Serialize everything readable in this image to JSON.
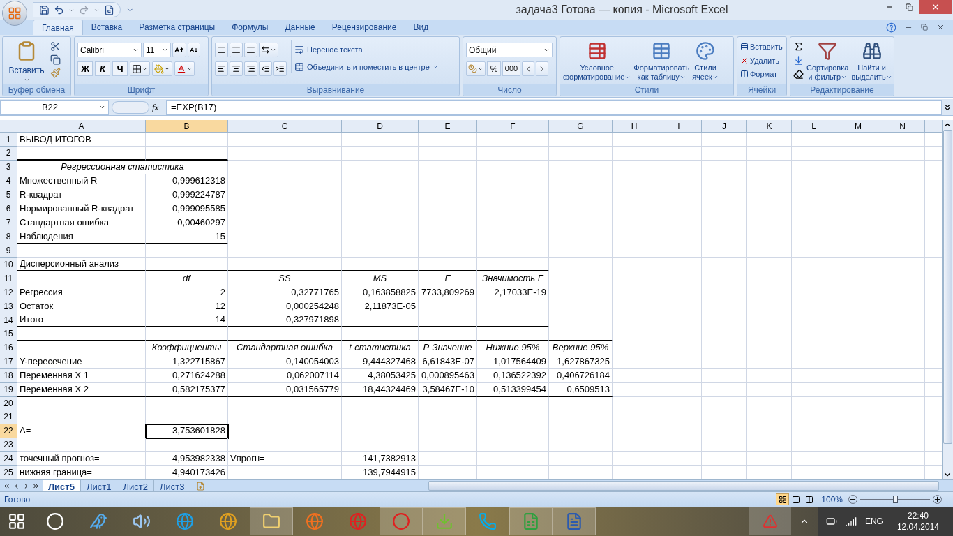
{
  "window": {
    "title": "задача3 Готова — копия - Microsoft Excel"
  },
  "ribbon_tabs": [
    {
      "label": "Главная",
      "selected": true
    },
    {
      "label": "Вставка",
      "selected": false
    },
    {
      "label": "Разметка страницы",
      "selected": false
    },
    {
      "label": "Формулы",
      "selected": false
    },
    {
      "label": "Данные",
      "selected": false
    },
    {
      "label": "Рецензирование",
      "selected": false
    },
    {
      "label": "Вид",
      "selected": false
    }
  ],
  "ribbon": {
    "clipboard": {
      "paste": "Вставить",
      "label": "Буфер обмена"
    },
    "font": {
      "name": "Calibri",
      "size": "11",
      "bold": "Ж",
      "italic": "К",
      "underline": "Ч",
      "label": "Шрифт"
    },
    "alignment": {
      "wrap": "Перенос текста",
      "merge": "Объединить и поместить в центре",
      "label": "Выравнивание"
    },
    "number": {
      "format": "Общий",
      "percent": "%",
      "thousands": "000",
      "label": "Число"
    },
    "styles": {
      "buttons": [
        [
          "Условное",
          "форматирование"
        ],
        [
          "Форматировать",
          "как таблицу"
        ],
        [
          "Стили",
          "ячеек"
        ]
      ],
      "label": "Стили"
    },
    "cells": {
      "buttons": [
        "Вставить",
        "Удалить",
        "Формат"
      ],
      "label": "Ячейки"
    },
    "editing": {
      "buttons": [
        [
          "Сортировка",
          "и фильтр"
        ],
        [
          "Найти и",
          "выделить"
        ]
      ],
      "label": "Редактирование"
    }
  },
  "formula_bar": {
    "name_box": "B22",
    "fx": "fx",
    "formula": "=EXP(B17)"
  },
  "columns": [
    {
      "label": "A",
      "selected": false
    },
    {
      "label": "B",
      "selected": true
    },
    {
      "label": "C",
      "selected": false
    },
    {
      "label": "D",
      "selected": false
    },
    {
      "label": "E",
      "selected": false
    },
    {
      "label": "F",
      "selected": false
    },
    {
      "label": "G",
      "selected": false
    },
    {
      "label": "H",
      "selected": false
    },
    {
      "label": "I",
      "selected": false
    },
    {
      "label": "J",
      "selected": false
    },
    {
      "label": "K",
      "selected": false
    },
    {
      "label": "L",
      "selected": false
    },
    {
      "label": "M",
      "selected": false
    },
    {
      "label": "N",
      "selected": false
    }
  ],
  "rows": [
    {
      "num": "1",
      "selected": false,
      "cells": [
        {
          "text": "ВЫВОД ИТОГОВ",
          "kind": "text"
        }
      ]
    },
    {
      "num": "2",
      "selected": false,
      "rule_below": [
        true,
        true
      ],
      "cells": []
    },
    {
      "num": "3",
      "selected": false,
      "cells": [
        {
          "text": "Регрессионная статистика",
          "kind": "merged_head"
        }
      ]
    },
    {
      "num": "4",
      "selected": false,
      "cells": [
        {
          "text": "Множественный R",
          "kind": "text"
        },
        {
          "text": "0,999612318",
          "kind": "number"
        }
      ]
    },
    {
      "num": "5",
      "selected": false,
      "cells": [
        {
          "text": "R-квадрат",
          "kind": "text"
        },
        {
          "text": "0,999224787",
          "kind": "number"
        }
      ]
    },
    {
      "num": "6",
      "selected": false,
      "cells": [
        {
          "text": "Нормированный R-квадрат",
          "kind": "text"
        },
        {
          "text": "0,999095585",
          "kind": "number"
        }
      ]
    },
    {
      "num": "7",
      "selected": false,
      "cells": [
        {
          "text": "Стандартная ошибка",
          "kind": "text"
        },
        {
          "text": "0,00460297",
          "kind": "number"
        }
      ]
    },
    {
      "num": "8",
      "selected": false,
      "rule_below": [
        true,
        true
      ],
      "cells": [
        {
          "text": "Наблюдения",
          "kind": "text"
        },
        {
          "text": "15",
          "kind": "number"
        }
      ]
    },
    {
      "num": "9",
      "selected": false,
      "cells": []
    },
    {
      "num": "10",
      "selected": false,
      "rule_below": [
        true,
        true,
        true,
        true,
        true,
        true
      ],
      "cells": [
        {
          "text": "Дисперсионный анализ",
          "kind": "text"
        }
      ]
    },
    {
      "num": "11",
      "selected": false,
      "cells": [
        null,
        {
          "text": "df",
          "kind": "head"
        },
        {
          "text": "SS",
          "kind": "head"
        },
        {
          "text": "MS",
          "kind": "head"
        },
        {
          "text": "F",
          "kind": "head"
        },
        {
          "text": "Значимость F",
          "kind": "head"
        }
      ]
    },
    {
      "num": "12",
      "selected": false,
      "cells": [
        {
          "text": "Регрессия",
          "kind": "text"
        },
        {
          "text": "2",
          "kind": "number"
        },
        {
          "text": "0,32771765",
          "kind": "number"
        },
        {
          "text": "0,163858825",
          "kind": "number"
        },
        {
          "text": "7733,809269",
          "kind": "number"
        },
        {
          "text": "2,17033E-19",
          "kind": "number"
        }
      ]
    },
    {
      "num": "13",
      "selected": false,
      "cells": [
        {
          "text": "Остаток",
          "kind": "text"
        },
        {
          "text": "12",
          "kind": "number"
        },
        {
          "text": "0,000254248",
          "kind": "number"
        },
        {
          "text": "2,11873E-05",
          "kind": "number"
        }
      ]
    },
    {
      "num": "14",
      "selected": false,
      "rule_below": [
        true,
        true,
        true,
        true,
        true,
        true
      ],
      "cells": [
        {
          "text": "Итого",
          "kind": "text"
        },
        {
          "text": "14",
          "kind": "number"
        },
        {
          "text": "0,327971898",
          "kind": "number"
        }
      ]
    },
    {
      "num": "15",
      "selected": false,
      "rule_below": [
        true,
        true,
        true,
        true,
        true,
        true,
        true
      ],
      "cells": []
    },
    {
      "num": "16",
      "selected": false,
      "cells": [
        null,
        {
          "text": "Коэффициенты",
          "kind": "head"
        },
        {
          "text": "Стандартная ошибка",
          "kind": "head"
        },
        {
          "text": "t-статистика",
          "kind": "head"
        },
        {
          "text": "P-Значение",
          "kind": "head"
        },
        {
          "text": "Нижние 95%",
          "kind": "head"
        },
        {
          "text": "Верхние 95%",
          "kind": "head"
        }
      ]
    },
    {
      "num": "17",
      "selected": false,
      "cells": [
        {
          "text": "Y-пересечение",
          "kind": "text"
        },
        {
          "text": "1,322715867",
          "kind": "number"
        },
        {
          "text": "0,140054003",
          "kind": "number"
        },
        {
          "text": "9,444327468",
          "kind": "number"
        },
        {
          "text": "6,61843E-07",
          "kind": "number"
        },
        {
          "text": "1,017564409",
          "kind": "number"
        },
        {
          "text": "1,627867325",
          "kind": "number"
        }
      ]
    },
    {
      "num": "18",
      "selected": false,
      "cells": [
        {
          "text": "Переменная X 1",
          "kind": "text"
        },
        {
          "text": "0,271624288",
          "kind": "number"
        },
        {
          "text": "0,062007114",
          "kind": "number"
        },
        {
          "text": "4,38053425",
          "kind": "number"
        },
        {
          "text": "0,000895463",
          "kind": "number"
        },
        {
          "text": "0,136522392",
          "kind": "number"
        },
        {
          "text": "0,406726184",
          "kind": "number"
        }
      ]
    },
    {
      "num": "19",
      "selected": false,
      "rule_below": [
        true,
        true,
        true,
        true,
        true,
        true,
        true
      ],
      "cells": [
        {
          "text": "Переменная X 2",
          "kind": "text"
        },
        {
          "text": "0,582175377",
          "kind": "number"
        },
        {
          "text": "0,031565779",
          "kind": "number"
        },
        {
          "text": "18,44324469",
          "kind": "number"
        },
        {
          "text": "3,58467E-10",
          "kind": "number"
        },
        {
          "text": "0,513399454",
          "kind": "number"
        },
        {
          "text": "0,6509513",
          "kind": "number"
        }
      ]
    },
    {
      "num": "20",
      "selected": false,
      "cells": []
    },
    {
      "num": "21",
      "selected": false,
      "cells": []
    },
    {
      "num": "22",
      "selected": true,
      "cells": [
        {
          "text": "A=",
          "kind": "text"
        },
        {
          "text": "3,753601828",
          "kind": "number",
          "selected": true
        }
      ]
    },
    {
      "num": "23",
      "selected": false,
      "cells": []
    },
    {
      "num": "24",
      "selected": false,
      "cells": [
        {
          "text": "точечный прогноз=",
          "kind": "text"
        },
        {
          "text": "4,953982338",
          "kind": "number"
        },
        {
          "text": "Vпрогн=",
          "kind": "text"
        },
        {
          "text": "141,7382913",
          "kind": "number"
        }
      ]
    },
    {
      "num": "25",
      "selected": false,
      "cells": [
        {
          "text": "нижняя граница=",
          "kind": "text"
        },
        {
          "text": "4,940173426",
          "kind": "number"
        },
        null,
        {
          "text": "139,7944915",
          "kind": "number"
        }
      ]
    }
  ],
  "sheet_tabs": [
    {
      "label": "Лист5",
      "selected": true
    },
    {
      "label": "Лист1",
      "selected": false
    },
    {
      "label": "Лист2",
      "selected": false
    },
    {
      "label": "Лист3",
      "selected": false
    }
  ],
  "status_bar": {
    "status": "Готово",
    "view_buttons": [
      {
        "selected": true
      },
      {
        "selected": false
      },
      {
        "selected": false
      }
    ],
    "zoom": "100%",
    "zoom_slider": {
      "level": 0.5
    }
  },
  "taskbar": {
    "lang": "ENG",
    "time": "22:40",
    "date": "12.04.2014"
  }
}
